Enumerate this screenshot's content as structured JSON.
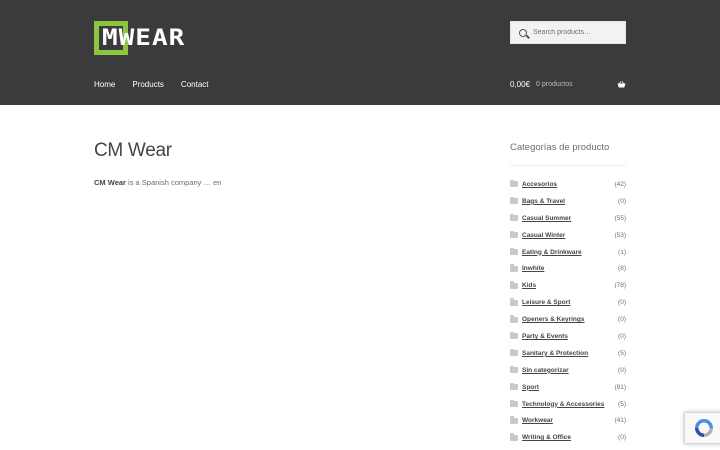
{
  "site": {
    "logo_text": "MWEAR"
  },
  "search": {
    "placeholder": "Search products…"
  },
  "nav": {
    "items": [
      {
        "label": "Home"
      },
      {
        "label": "Products"
      },
      {
        "label": "Contact"
      }
    ]
  },
  "cart": {
    "amount": "0,00€",
    "count_label": "0 productos"
  },
  "main": {
    "title": "CM Wear",
    "excerpt_bold": "CM Wear",
    "excerpt_rest": " is a Spanish company … en"
  },
  "sidebar": {
    "widget_title": "Categorías de producto",
    "categories": [
      {
        "label": "Accesorios",
        "count": "(42)"
      },
      {
        "label": "Bags & Travel",
        "count": "(0)"
      },
      {
        "label": "Casual Summer",
        "count": "(55)"
      },
      {
        "label": "Casual Winter",
        "count": "(53)"
      },
      {
        "label": "Eating & Drinkware",
        "count": "(1)"
      },
      {
        "label": "Inwhite",
        "count": "(8)"
      },
      {
        "label": "Kids",
        "count": "(78)"
      },
      {
        "label": "Leisure & Sport",
        "count": "(0)"
      },
      {
        "label": "Openers & Keyrings",
        "count": "(0)"
      },
      {
        "label": "Party & Events",
        "count": "(0)"
      },
      {
        "label": "Sanitary & Protection",
        "count": "(5)"
      },
      {
        "label": "Sin categorizar",
        "count": "(0)"
      },
      {
        "label": "Sport",
        "count": "(91)"
      },
      {
        "label": "Technology & Accessories",
        "count": "(5)"
      },
      {
        "label": "Workwear",
        "count": "(41)"
      },
      {
        "label": "Writing & Office",
        "count": "(0)"
      }
    ]
  },
  "colors": {
    "header_bg": "#3b3b3d",
    "logo_accent": "#8cc63f",
    "text": "#43454b",
    "muted": "#6d6d6d"
  },
  "icons": [
    "search-icon",
    "basket-icon",
    "folder-icon",
    "recaptcha-icon"
  ]
}
